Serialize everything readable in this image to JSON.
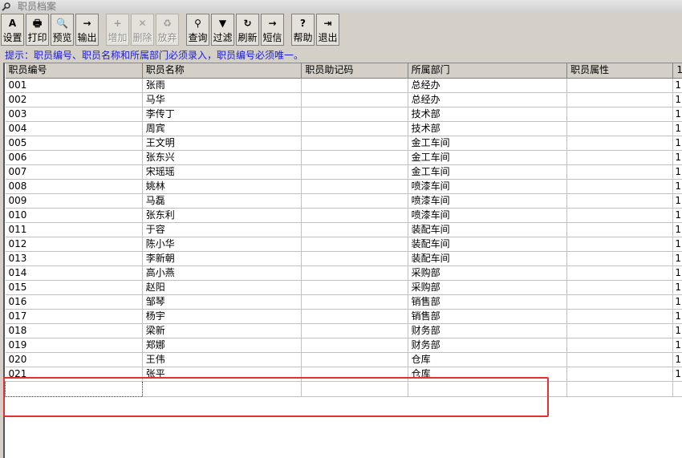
{
  "window": {
    "title": "职员档案"
  },
  "toolbar": {
    "buttons": [
      {
        "label": "设置",
        "icon": "settings-icon",
        "glyph": "A",
        "enabled": true
      },
      {
        "label": "打印",
        "icon": "printer-icon",
        "glyph": "🖶",
        "enabled": true
      },
      {
        "label": "预览",
        "icon": "preview-icon",
        "glyph": "🔍",
        "enabled": true
      },
      {
        "label": "输出",
        "icon": "export-icon",
        "glyph": "→",
        "enabled": true
      },
      {
        "label": "增加",
        "icon": "add-icon",
        "glyph": "+",
        "enabled": false
      },
      {
        "label": "删除",
        "icon": "delete-icon",
        "glyph": "✕",
        "enabled": false
      },
      {
        "label": "放弃",
        "icon": "discard-icon",
        "glyph": "♻",
        "enabled": false
      },
      {
        "label": "查询",
        "icon": "binoculars-icon",
        "glyph": "⚲",
        "enabled": true
      },
      {
        "label": "过滤",
        "icon": "filter-icon",
        "glyph": "▼",
        "enabled": true
      },
      {
        "label": "刷新",
        "icon": "refresh-icon",
        "glyph": "↻",
        "enabled": true
      },
      {
        "label": "短信",
        "icon": "sms-icon",
        "glyph": "→",
        "enabled": true
      },
      {
        "label": "帮助",
        "icon": "help-icon",
        "glyph": "?",
        "enabled": true
      },
      {
        "label": "退出",
        "icon": "exit-icon",
        "glyph": "⇥",
        "enabled": true
      }
    ]
  },
  "hint": "提示：职员编号、职员名称和所属部门必须录入，职员编号必须唯一。",
  "table": {
    "columns": [
      "职员编号",
      "职员名称",
      "职员助记码",
      "所属部门",
      "职员属性",
      "1"
    ],
    "rows": [
      [
        "001",
        "张雨",
        "",
        "总经办",
        "",
        "1"
      ],
      [
        "002",
        "马华",
        "",
        "总经办",
        "",
        "1"
      ],
      [
        "003",
        "李传丁",
        "",
        "技术部",
        "",
        "1"
      ],
      [
        "004",
        "周宾",
        "",
        "技术部",
        "",
        "1"
      ],
      [
        "005",
        "王文明",
        "",
        "金工车间",
        "",
        "1"
      ],
      [
        "006",
        "张东兴",
        "",
        "金工车间",
        "",
        "1"
      ],
      [
        "007",
        "宋瑶瑶",
        "",
        "金工车间",
        "",
        "1"
      ],
      [
        "008",
        "姚林",
        "",
        "喷漆车间",
        "",
        "1"
      ],
      [
        "009",
        "马磊",
        "",
        "喷漆车间",
        "",
        "1"
      ],
      [
        "010",
        "张东利",
        "",
        "喷漆车间",
        "",
        "1"
      ],
      [
        "011",
        "于容",
        "",
        "装配车间",
        "",
        "1"
      ],
      [
        "012",
        "陈小华",
        "",
        "装配车间",
        "",
        "1"
      ],
      [
        "013",
        "李新朝",
        "",
        "装配车间",
        "",
        "1"
      ],
      [
        "014",
        "高小燕",
        "",
        "采购部",
        "",
        "1"
      ],
      [
        "015",
        "赵阳",
        "",
        "采购部",
        "",
        "1"
      ],
      [
        "016",
        "邹琴",
        "",
        "销售部",
        "",
        "1"
      ],
      [
        "017",
        "杨宇",
        "",
        "销售部",
        "",
        "1"
      ],
      [
        "018",
        "梁新",
        "",
        "财务部",
        "",
        "1"
      ],
      [
        "019",
        "郑娜",
        "",
        "财务部",
        "",
        "1"
      ],
      [
        "020",
        "王伟",
        "",
        "仓库",
        "",
        "1"
      ],
      [
        "021",
        "张平",
        "",
        "仓库",
        "",
        "1"
      ]
    ]
  },
  "colors": {
    "hint": "#1a1ae6",
    "highlight": "#e53030"
  }
}
